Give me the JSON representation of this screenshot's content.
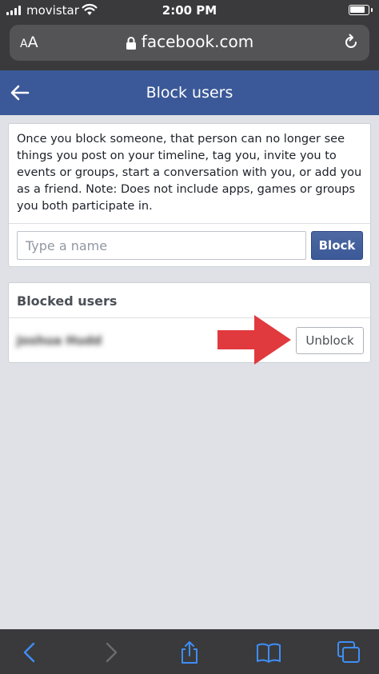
{
  "status_bar": {
    "carrier": "movistar",
    "time": "2:00 PM",
    "battery_level": 0.85
  },
  "address_bar": {
    "text_size_label_small": "A",
    "text_size_label_large": "A",
    "url": "facebook.com"
  },
  "header": {
    "title": "Block users"
  },
  "block_card": {
    "description": "Once you block someone, that person can no longer see things you post on your timeline, tag you, invite you to events or groups, start a conversation with you, or add you as a friend. Note: Does not include apps, games or groups you both participate in.",
    "input_placeholder": "Type a name",
    "input_value": "",
    "block_button_label": "Block"
  },
  "blocked_card": {
    "title": "Blocked users",
    "users": [
      {
        "name": "Joshua Hudd",
        "action_label": "Unblock"
      }
    ]
  },
  "colors": {
    "facebook_blue": "#3b5998",
    "arrow_red": "#e03a3e",
    "browser_chrome": "#3a3a3c",
    "browser_icon_blue": "#3e8ef7"
  },
  "toolbar": {
    "icons": [
      "back-icon",
      "forward-icon",
      "share-icon",
      "bookmarks-icon",
      "tabs-icon"
    ]
  }
}
